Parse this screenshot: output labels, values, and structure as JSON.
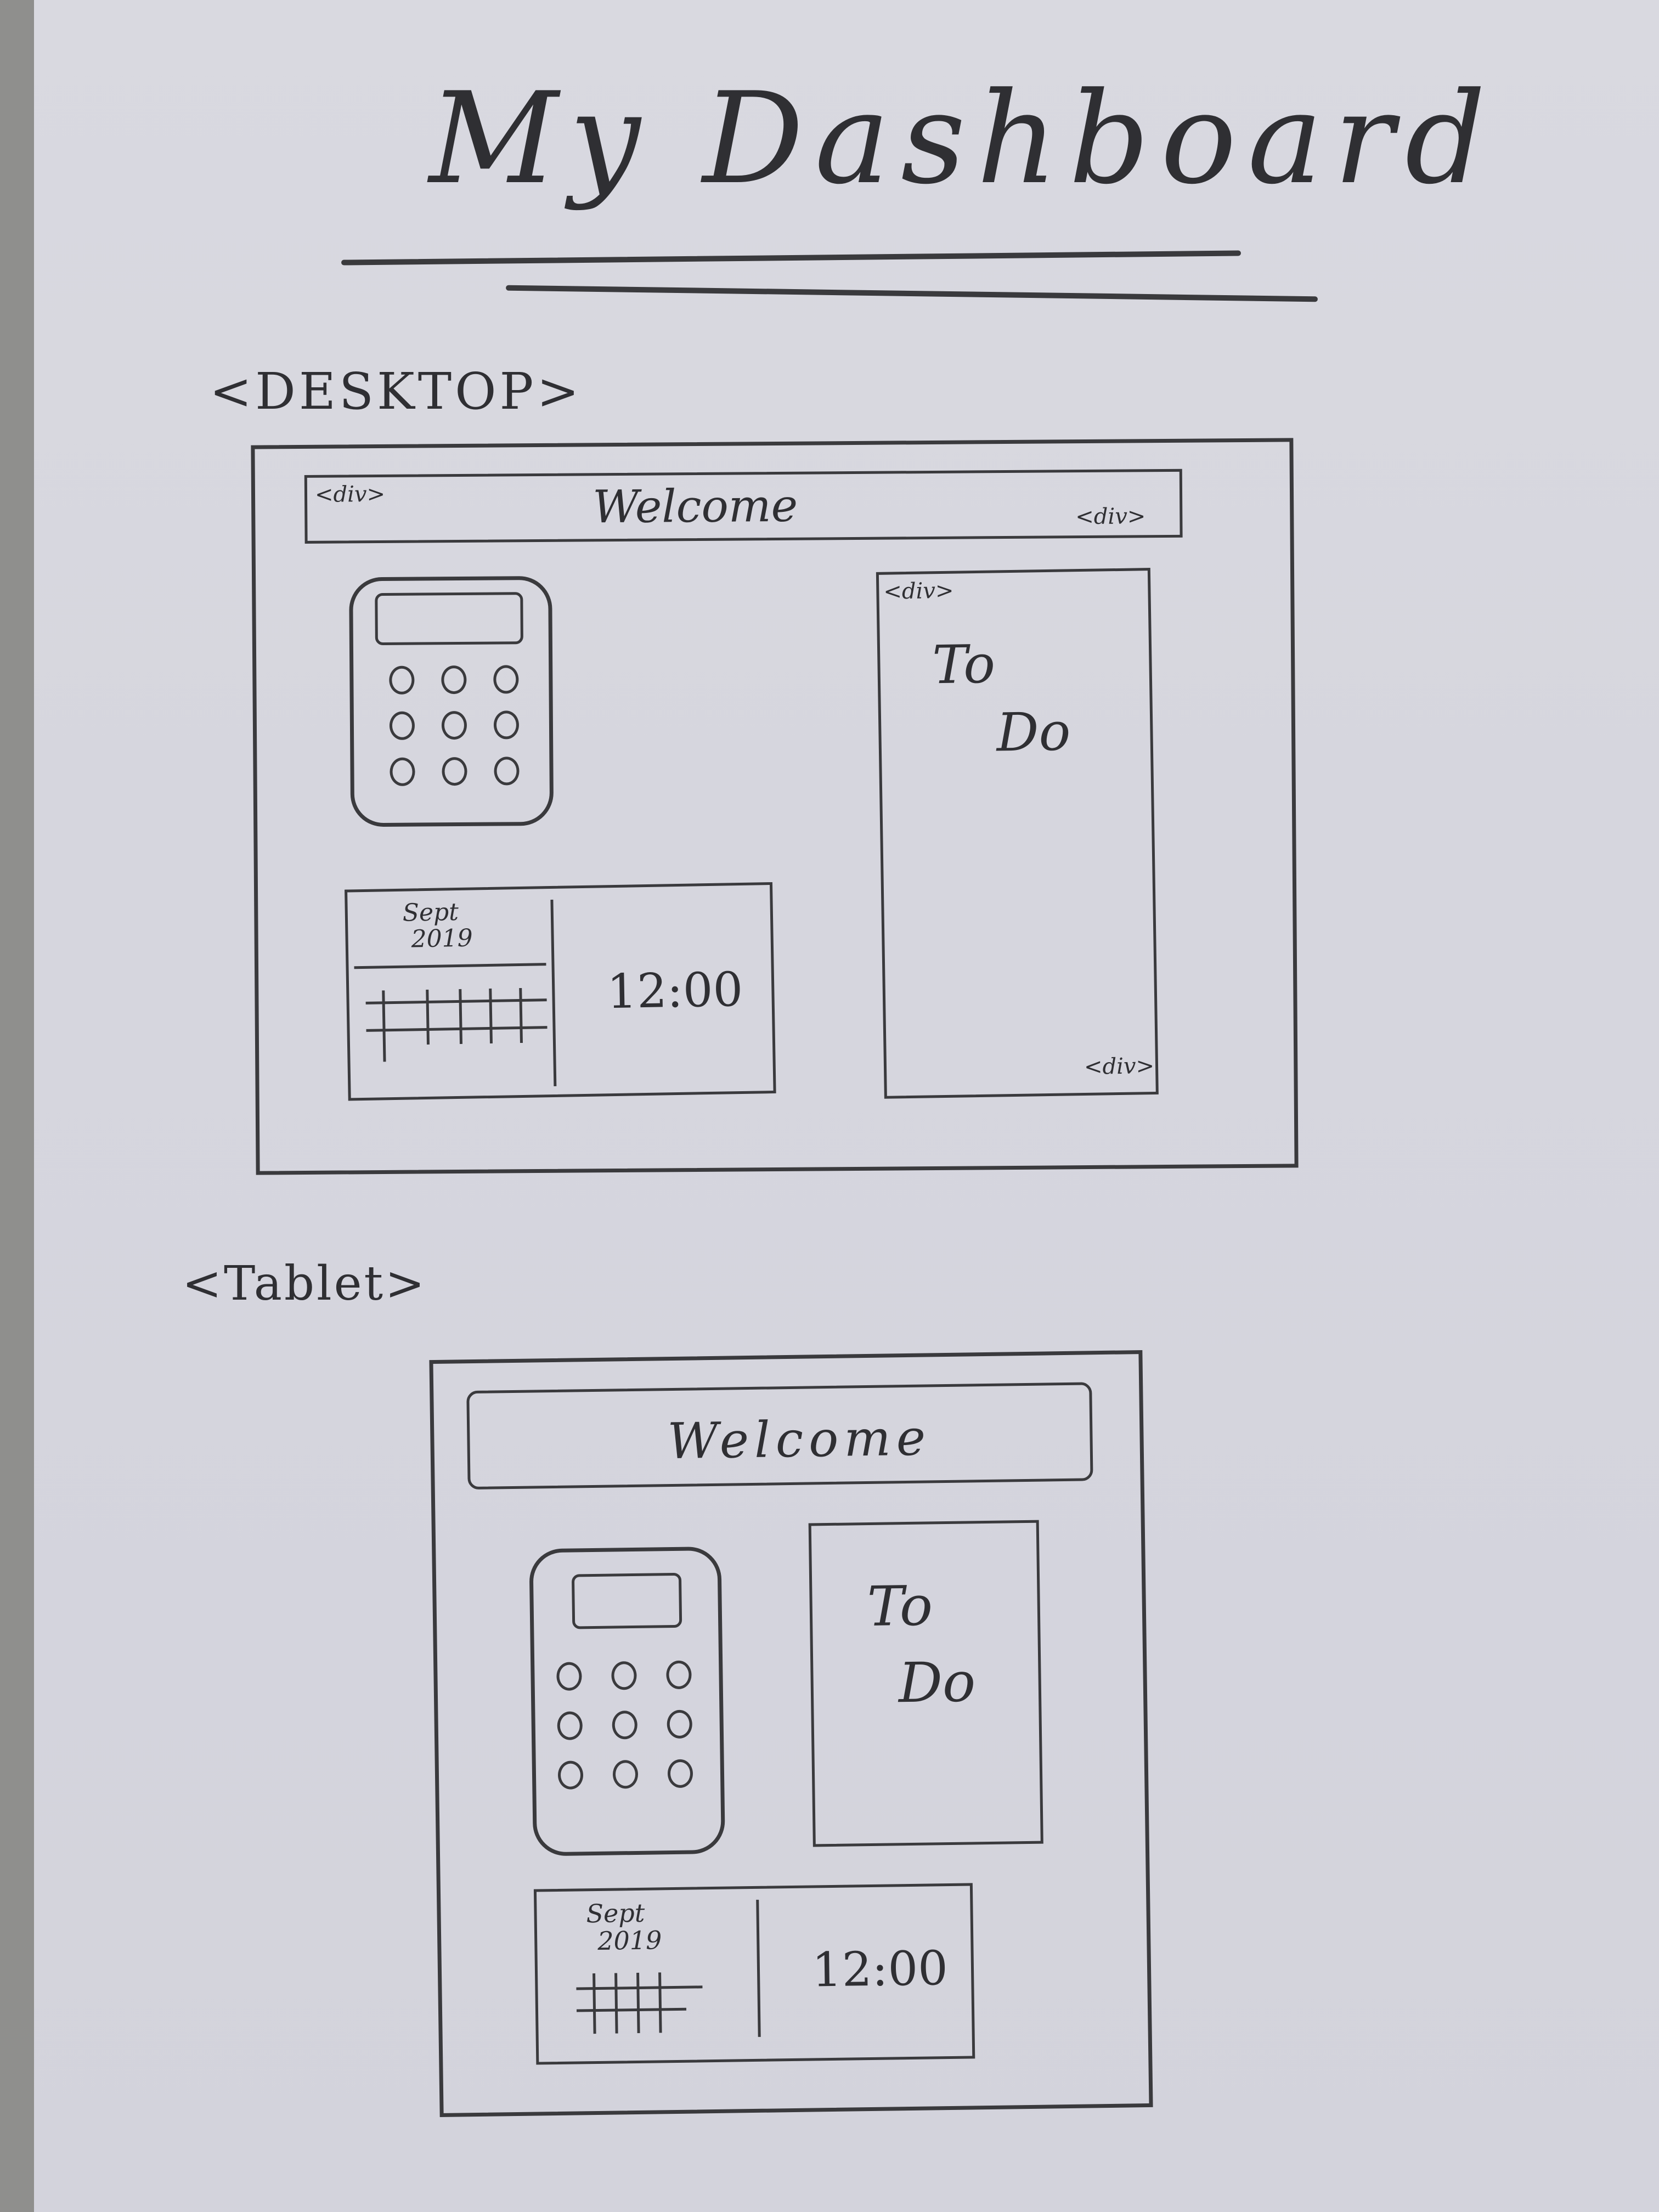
{
  "title": "My Dashboard",
  "desktop": {
    "label": "<DESKTOP>",
    "header_tag_left": "<div>",
    "header_text": "Welcome",
    "header_tag_right": "<div>",
    "todo_tag_top": "<div>",
    "todo_line1": "To",
    "todo_line2": "Do",
    "todo_tag_bottom": "<div>",
    "calendar_month": "Sept",
    "calendar_year": "2019",
    "clock": "12:00"
  },
  "tablet": {
    "label": "<Tablet>",
    "header_text": "Welcome",
    "todo_line1": "To",
    "todo_line2": "Do",
    "calendar_month": "Sept",
    "calendar_year": "2019",
    "clock": "12:00"
  },
  "colors": {
    "ink": "#3a3a3d",
    "paper": "#d6d6de",
    "background": "#8f8f8d"
  }
}
